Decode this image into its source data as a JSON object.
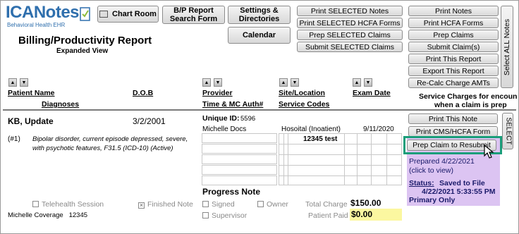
{
  "logo": {
    "brand": "ICANotes",
    "tagline": "Behavioral Health EHR"
  },
  "toolbar": {
    "chart_room": "Chart Room",
    "bp_report_line1": "B/P Report",
    "bp_report_line2": "Search Form",
    "settings_line1": "Settings &",
    "settings_line2": "Directories",
    "calendar": "Calendar",
    "print_selected_notes": "Print SELECTED Notes",
    "print_selected_hcfa": "Print SELECTED HCFA Forms",
    "prep_selected_claims": "Prep SELECTED Claims",
    "submit_selected_claims": "Submit SELECTED Claims",
    "print_notes": "Print Notes",
    "print_hcfa_forms": "Print HCFA Forms",
    "prep_claims": "Prep Claims",
    "submit_claims": "Submit Claim(s)",
    "print_this_report": "Print This Report",
    "export_this_report": "Export This Report",
    "recalc_charge": "Re-Calc Charge AMTs",
    "select_all_notes": "Select ALL Notes"
  },
  "report": {
    "title": "Billing/Productivity Report",
    "subtitle": "Expanded View"
  },
  "columns": {
    "patient_name": "Patient Name",
    "diagnoses": "Diagnoses",
    "dob": "D.O.B",
    "provider": "Provider",
    "time_mc_auth": "Time & MC Auth#",
    "site_location": "Site/Location",
    "service_codes": "Service Codes",
    "exam_date": "Exam Date",
    "service_charges_note_line1": "Service Charges for encoun",
    "service_charges_note_line2": "when a claim is prep"
  },
  "record": {
    "patient": "KB, Update",
    "dob": "3/2/2001",
    "unique_id_label": "Unique ID:",
    "unique_id": "5596",
    "provider": "Michelle Docs",
    "site": "Hosoital (Inoatient)",
    "exam_date": "9/11/2020",
    "diagnosis_num": "(#1)",
    "diagnosis": "Bipolar disorder, current episode depressed, severe, with psychotic features, F31.5 (ICD-10) (Active)",
    "service_code": "12345 test",
    "progress_note": "Progress Note",
    "telehealth": "Telehealth Session",
    "finished_note": "Finished Note",
    "signed": "Signed",
    "owner": "Owner",
    "supervisor": "Supervisor",
    "total_charge_label": "Total Charge",
    "total_charge": "$150.00",
    "patient_paid_label": "Patient Paid",
    "patient_paid": "$0.00",
    "coverage": "Michelle Coverage   12345",
    "print_this_note": "Print This Note",
    "print_cms_hcfa": "Print CMS/HCFA Form",
    "prep_claim_resubmit": "Prep Claim to Resubmit",
    "select": "SELECT",
    "prepared_line1": "Prepared 4/22/2021",
    "prepared_line2": "(click to view)",
    "status_label": "Status:",
    "status_value": "Saved to File",
    "status_time": "4/22/2021 5:33:55 PM",
    "primary_only": "Primary Only"
  },
  "colors": {
    "highlight_green": "#1a9e7a",
    "prepared_panel": "#dcc4f2",
    "paid_yellow": "#fbf7a0",
    "logo_green": "#8dbb3c",
    "logo_blue": "#2f6fad"
  }
}
